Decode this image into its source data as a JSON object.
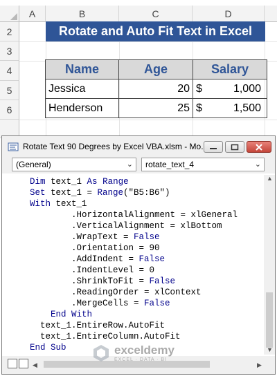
{
  "sheet": {
    "columns": [
      "A",
      "B",
      "C",
      "D"
    ],
    "rows": [
      "2",
      "3",
      "4",
      "5",
      "6"
    ],
    "title": "Rotate and Auto Fit Text in Excel",
    "table": {
      "headers": [
        "Name",
        "Age",
        "Salary"
      ],
      "rows": [
        {
          "name": "Jessica",
          "age": "20",
          "currency": "$",
          "salary": "1,000"
        },
        {
          "name": "Henderson",
          "age": "25",
          "currency": "$",
          "salary": "1,500"
        }
      ]
    }
  },
  "vba": {
    "window_title": "Rotate Text 90 Degrees by Excel VBA.xlsm - Mo...",
    "object_combo": "(General)",
    "procedure_combo": "rotate_text_4",
    "code_lines": [
      "Dim text_1 As Range",
      "Set text_1 = Range(\"B5:B6\")",
      "With text_1",
      "        .HorizontalAlignment = xlGeneral",
      "        .VerticalAlignment = xlBottom",
      "        .WrapText = False",
      "        .Orientation = 90",
      "        .AddIndent = False",
      "        .IndentLevel = 0",
      "        .ShrinkToFit = False",
      "        .ReadingOrder = xlContext",
      "        .MergeCells = False",
      "    End With",
      "  text_1.EntireRow.AutoFit",
      "  text_1.EntireColumn.AutoFit",
      "End Sub"
    ]
  },
  "watermark": {
    "name": "exceldemy",
    "tagline": "EXCEL · DATA · BI"
  },
  "colors": {
    "title_fill": "#2f5597",
    "header_fill": "#d9d9d9",
    "keyword": "#00008b"
  }
}
